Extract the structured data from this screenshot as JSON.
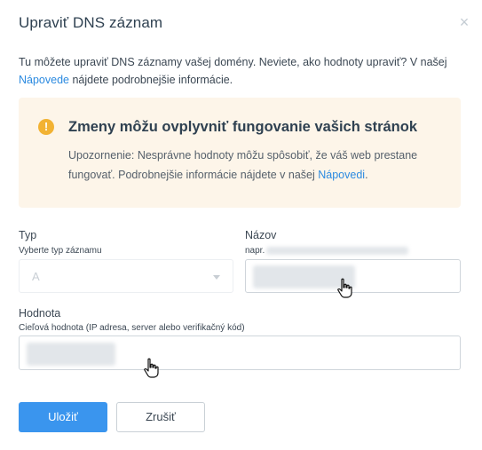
{
  "dialog": {
    "title": "Upraviť DNS záznam",
    "close_label": "×",
    "intro_text": "Tu môžete upraviť DNS záznamy vašej domény. Neviete, ako hodnoty upraviť? V našej",
    "intro_link": "Nápovede",
    "intro_suffix": " nájdete podrobnejšie informácie."
  },
  "warning": {
    "title": "Zmeny môžu ovplyvniť fungovanie vašich stránok",
    "text": "Upozornenie: Nesprávne hodnoty môžu spôsobiť, že váš web prestane fungovať. Podrobnejšie informácie nájdete v našej ",
    "link": "Nápovedi",
    "suffix": ".",
    "accent": "#f2b233"
  },
  "form": {
    "type_label": "Typ",
    "type_hint": "Vyberte typ záznamu",
    "type_value": "A",
    "name_label": "Názov",
    "name_hint_prefix": "napr.",
    "value_label": "Hodnota",
    "value_hint": "Cieľová hodnota (IP adresa, server alebo verifikačný kód)"
  },
  "buttons": {
    "save": "Uložiť",
    "cancel": "Zrušiť"
  },
  "colors": {
    "primary": "#3a95ee",
    "link": "#2b8ae0"
  }
}
